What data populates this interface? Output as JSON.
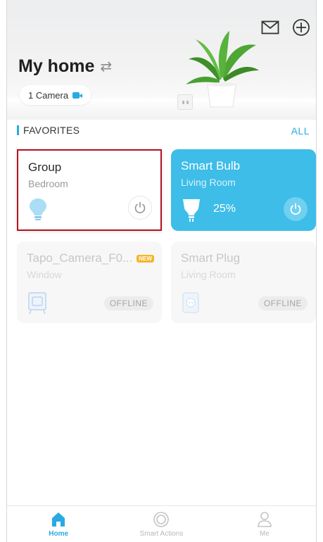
{
  "header": {
    "title": "My home",
    "camera_chip": "1 Camera"
  },
  "favorites": {
    "label": "FAVORITES",
    "all_link": "ALL"
  },
  "devices": [
    {
      "name": "Group",
      "room": "Bedroom",
      "icon": "bulb-icon",
      "status": "power"
    },
    {
      "name": "Smart Bulb",
      "room": "Living Room",
      "icon": "bulb-icon",
      "brightness": "25%",
      "status": "power"
    },
    {
      "name": "Tapo_Camera_F0...",
      "room": "Window",
      "icon": "camera-device-icon",
      "badge": "NEW",
      "status": "OFFLINE"
    },
    {
      "name": "Smart Plug",
      "room": "Living Room",
      "icon": "plug-icon",
      "status": "OFFLINE"
    }
  ],
  "tabs": [
    {
      "label": "Home",
      "icon": "home-icon",
      "active": true
    },
    {
      "label": "Smart Actions",
      "icon": "smart-actions-icon",
      "active": false
    },
    {
      "label": "Me",
      "icon": "person-icon",
      "active": false
    }
  ],
  "colors": {
    "accent": "#29abe2",
    "bulb_card": "#3dbde8",
    "highlight_border": "#b4121e"
  }
}
